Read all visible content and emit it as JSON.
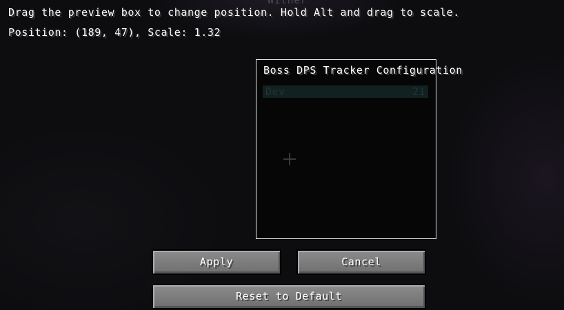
{
  "background": {
    "ghost_text": "Wither"
  },
  "instructions": {
    "line1": "Drag the preview box to change position. Hold Alt and drag to scale.",
    "line2": "Position: (189, 47), Scale: 1.32"
  },
  "preview": {
    "title": "Boss DPS Tracker Configuration",
    "rows": [
      {
        "name": "Dev",
        "value": "21"
      }
    ]
  },
  "buttons": {
    "apply": "Apply",
    "cancel": "Cancel",
    "reset": "Reset to Default"
  }
}
